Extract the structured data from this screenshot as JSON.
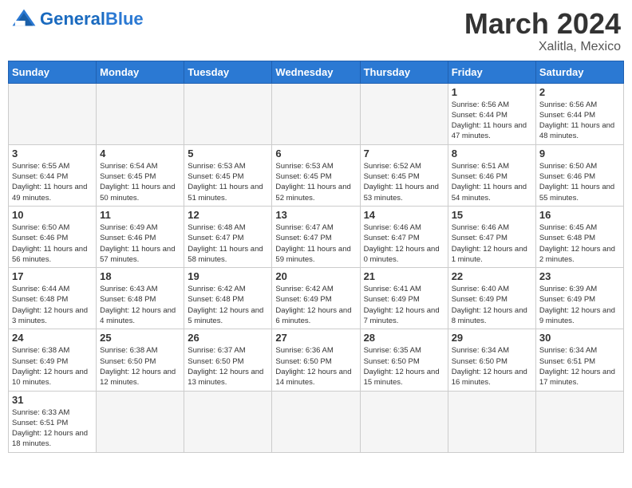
{
  "header": {
    "logo_general": "General",
    "logo_blue": "Blue",
    "month_title": "March 2024",
    "subtitle": "Xalitla, Mexico"
  },
  "days_of_week": [
    "Sunday",
    "Monday",
    "Tuesday",
    "Wednesday",
    "Thursday",
    "Friday",
    "Saturday"
  ],
  "weeks": [
    {
      "days": [
        {
          "num": "",
          "info": ""
        },
        {
          "num": "",
          "info": ""
        },
        {
          "num": "",
          "info": ""
        },
        {
          "num": "",
          "info": ""
        },
        {
          "num": "",
          "info": ""
        },
        {
          "num": "1",
          "info": "Sunrise: 6:56 AM\nSunset: 6:44 PM\nDaylight: 11 hours\nand 47 minutes."
        },
        {
          "num": "2",
          "info": "Sunrise: 6:56 AM\nSunset: 6:44 PM\nDaylight: 11 hours\nand 48 minutes."
        }
      ]
    },
    {
      "days": [
        {
          "num": "3",
          "info": "Sunrise: 6:55 AM\nSunset: 6:44 PM\nDaylight: 11 hours\nand 49 minutes."
        },
        {
          "num": "4",
          "info": "Sunrise: 6:54 AM\nSunset: 6:45 PM\nDaylight: 11 hours\nand 50 minutes."
        },
        {
          "num": "5",
          "info": "Sunrise: 6:53 AM\nSunset: 6:45 PM\nDaylight: 11 hours\nand 51 minutes."
        },
        {
          "num": "6",
          "info": "Sunrise: 6:53 AM\nSunset: 6:45 PM\nDaylight: 11 hours\nand 52 minutes."
        },
        {
          "num": "7",
          "info": "Sunrise: 6:52 AM\nSunset: 6:45 PM\nDaylight: 11 hours\nand 53 minutes."
        },
        {
          "num": "8",
          "info": "Sunrise: 6:51 AM\nSunset: 6:46 PM\nDaylight: 11 hours\nand 54 minutes."
        },
        {
          "num": "9",
          "info": "Sunrise: 6:50 AM\nSunset: 6:46 PM\nDaylight: 11 hours\nand 55 minutes."
        }
      ]
    },
    {
      "days": [
        {
          "num": "10",
          "info": "Sunrise: 6:50 AM\nSunset: 6:46 PM\nDaylight: 11 hours\nand 56 minutes."
        },
        {
          "num": "11",
          "info": "Sunrise: 6:49 AM\nSunset: 6:46 PM\nDaylight: 11 hours\nand 57 minutes."
        },
        {
          "num": "12",
          "info": "Sunrise: 6:48 AM\nSunset: 6:47 PM\nDaylight: 11 hours\nand 58 minutes."
        },
        {
          "num": "13",
          "info": "Sunrise: 6:47 AM\nSunset: 6:47 PM\nDaylight: 11 hours\nand 59 minutes."
        },
        {
          "num": "14",
          "info": "Sunrise: 6:46 AM\nSunset: 6:47 PM\nDaylight: 12 hours\nand 0 minutes."
        },
        {
          "num": "15",
          "info": "Sunrise: 6:46 AM\nSunset: 6:47 PM\nDaylight: 12 hours\nand 1 minute."
        },
        {
          "num": "16",
          "info": "Sunrise: 6:45 AM\nSunset: 6:48 PM\nDaylight: 12 hours\nand 2 minutes."
        }
      ]
    },
    {
      "days": [
        {
          "num": "17",
          "info": "Sunrise: 6:44 AM\nSunset: 6:48 PM\nDaylight: 12 hours\nand 3 minutes."
        },
        {
          "num": "18",
          "info": "Sunrise: 6:43 AM\nSunset: 6:48 PM\nDaylight: 12 hours\nand 4 minutes."
        },
        {
          "num": "19",
          "info": "Sunrise: 6:42 AM\nSunset: 6:48 PM\nDaylight: 12 hours\nand 5 minutes."
        },
        {
          "num": "20",
          "info": "Sunrise: 6:42 AM\nSunset: 6:49 PM\nDaylight: 12 hours\nand 6 minutes."
        },
        {
          "num": "21",
          "info": "Sunrise: 6:41 AM\nSunset: 6:49 PM\nDaylight: 12 hours\nand 7 minutes."
        },
        {
          "num": "22",
          "info": "Sunrise: 6:40 AM\nSunset: 6:49 PM\nDaylight: 12 hours\nand 8 minutes."
        },
        {
          "num": "23",
          "info": "Sunrise: 6:39 AM\nSunset: 6:49 PM\nDaylight: 12 hours\nand 9 minutes."
        }
      ]
    },
    {
      "days": [
        {
          "num": "24",
          "info": "Sunrise: 6:38 AM\nSunset: 6:49 PM\nDaylight: 12 hours\nand 10 minutes."
        },
        {
          "num": "25",
          "info": "Sunrise: 6:38 AM\nSunset: 6:50 PM\nDaylight: 12 hours\nand 12 minutes."
        },
        {
          "num": "26",
          "info": "Sunrise: 6:37 AM\nSunset: 6:50 PM\nDaylight: 12 hours\nand 13 minutes."
        },
        {
          "num": "27",
          "info": "Sunrise: 6:36 AM\nSunset: 6:50 PM\nDaylight: 12 hours\nand 14 minutes."
        },
        {
          "num": "28",
          "info": "Sunrise: 6:35 AM\nSunset: 6:50 PM\nDaylight: 12 hours\nand 15 minutes."
        },
        {
          "num": "29",
          "info": "Sunrise: 6:34 AM\nSunset: 6:50 PM\nDaylight: 12 hours\nand 16 minutes."
        },
        {
          "num": "30",
          "info": "Sunrise: 6:34 AM\nSunset: 6:51 PM\nDaylight: 12 hours\nand 17 minutes."
        }
      ]
    },
    {
      "days": [
        {
          "num": "31",
          "info": "Sunrise: 6:33 AM\nSunset: 6:51 PM\nDaylight: 12 hours\nand 18 minutes."
        },
        {
          "num": "",
          "info": ""
        },
        {
          "num": "",
          "info": ""
        },
        {
          "num": "",
          "info": ""
        },
        {
          "num": "",
          "info": ""
        },
        {
          "num": "",
          "info": ""
        },
        {
          "num": "",
          "info": ""
        }
      ]
    }
  ]
}
